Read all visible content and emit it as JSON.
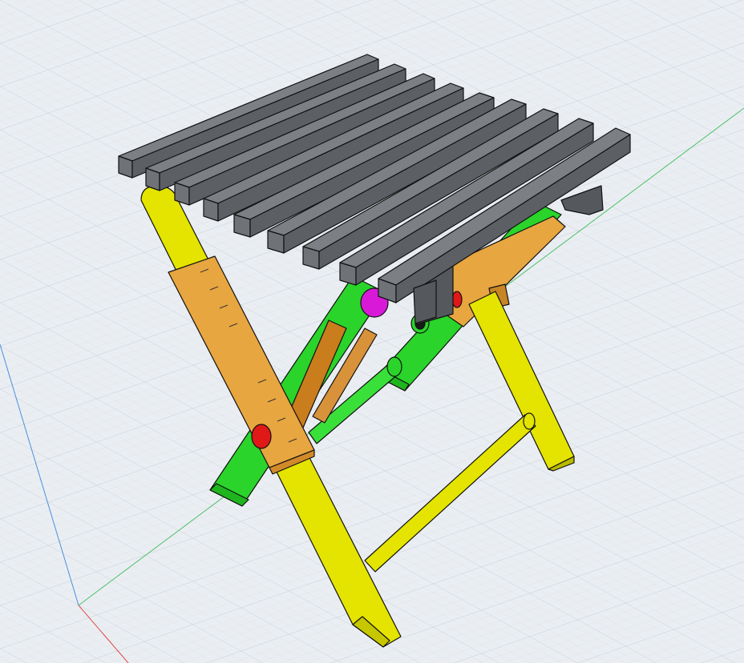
{
  "viewport": {
    "label": "",
    "background": "#e9edf1",
    "grid_color": "#c9d3dc",
    "grid_minor_color": "#dbe2e8"
  },
  "axes": {
    "x_color": "#e04a4a",
    "y_color": "#4fbf6a",
    "z_color": "#4a8fe0"
  },
  "model": {
    "name": "",
    "parts": [
      {
        "id": "seat-slats",
        "color": "#6f7378"
      },
      {
        "id": "front-legs",
        "color": "#e4e400"
      },
      {
        "id": "rear-legs",
        "color": "#28d428"
      },
      {
        "id": "side-rails",
        "color": "#e8a640"
      },
      {
        "id": "stretcher-bar",
        "color": "#e4e400"
      },
      {
        "id": "pivot-bolt-red",
        "color": "#e01818"
      },
      {
        "id": "pivot-bolt-magenta",
        "color": "#d81ad8"
      }
    ]
  }
}
